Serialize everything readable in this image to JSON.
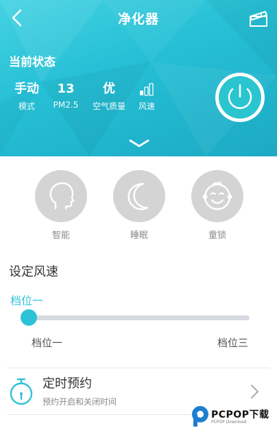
{
  "header": {
    "title": "净化器",
    "back_icon": "chevron-left-icon",
    "menu_icon": "clapperboard-icon"
  },
  "status": {
    "heading": "当前状态",
    "mode": {
      "value": "手动",
      "label": "模式"
    },
    "pm25": {
      "value": "13",
      "label": "PM2.5"
    },
    "air_quality": {
      "value": "优",
      "label": "空气质量"
    },
    "fan_speed": {
      "icon": "signal-bars-icon",
      "label": "风速",
      "bars_lit": 1,
      "bars_total": 3
    },
    "power_icon": "power-icon",
    "expand_icon": "chevron-down-icon"
  },
  "modes": [
    {
      "label": "智能",
      "icon": "head-icon"
    },
    {
      "label": "睡眠",
      "icon": "moon-icon"
    },
    {
      "label": "童锁",
      "icon": "baby-face-icon"
    }
  ],
  "fan_setting": {
    "title": "设定风速",
    "current": "档位一",
    "min_label": "档位一",
    "max_label": "档位三",
    "level_fraction": 0
  },
  "timer": {
    "title": "定时预约",
    "subtitle": "预约开启和关闭时间",
    "icon": "stopwatch-icon",
    "arrow_icon": "chevron-right-icon"
  },
  "watermark": {
    "text": "PCPOP下载",
    "sub": "PCPOP Download"
  },
  "colors": {
    "accent": "#2ec2d8",
    "header_gradient_start": "#44d3e3",
    "header_gradient_end": "#1ea9c4",
    "mode_circle": "#d4d4d4",
    "track": "#d6d8df",
    "watermark_blue": "#1e7fd0"
  }
}
